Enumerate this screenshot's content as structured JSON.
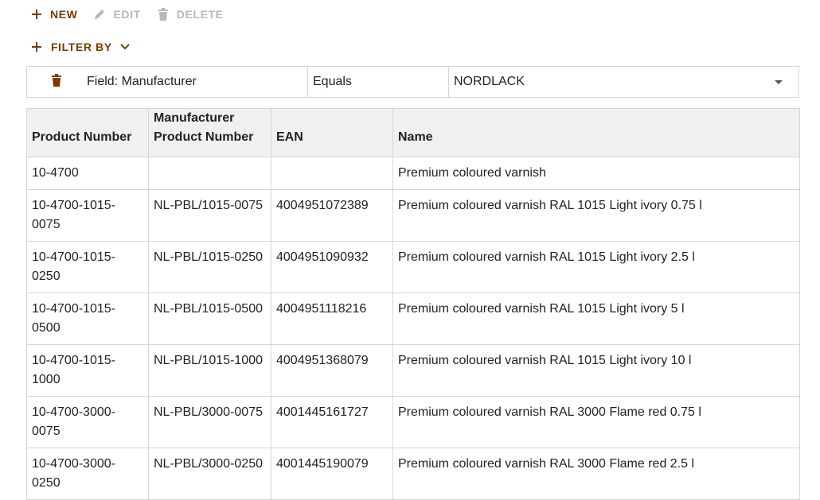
{
  "toolbar": {
    "new_label": "NEW",
    "edit_label": "EDIT",
    "delete_label": "DELETE"
  },
  "filter": {
    "filter_by_label": "FILTER BY",
    "field_label": "Field: Manufacturer",
    "operator": "Equals",
    "value": "NORDLACK"
  },
  "table": {
    "headers": [
      "Product Number",
      "Manufacturer Product Number",
      "EAN",
      "Name"
    ],
    "rows": [
      [
        "10-4700",
        "",
        "",
        "Premium coloured varnish"
      ],
      [
        "10-4700-1015-0075",
        "NL-PBL/1015-0075",
        "4004951072389",
        "Premium coloured varnish RAL 1015 Light ivory 0.75 l"
      ],
      [
        "10-4700-1015-0250",
        "NL-PBL/1015-0250",
        "4004951090932",
        "Premium coloured varnish RAL 1015 Light ivory 2.5 l"
      ],
      [
        "10-4700-1015-0500",
        "NL-PBL/1015-0500",
        "4004951118216",
        "Premium coloured varnish RAL 1015 Light ivory 5 l"
      ],
      [
        "10-4700-1015-1000",
        "NL-PBL/1015-1000",
        "4004951368079",
        "Premium coloured varnish RAL 1015 Light ivory 10 l"
      ],
      [
        "10-4700-3000-0075",
        "NL-PBL/3000-0075",
        "4001445161727",
        "Premium coloured varnish RAL 3000 Flame red 0.75 l"
      ],
      [
        "10-4700-3000-0250",
        "NL-PBL/3000-0250",
        "4001445190079",
        "Premium coloured varnish RAL 3000 Flame red 2.5 l"
      ]
    ]
  },
  "colors": {
    "accent": "#7a3a00",
    "disabled": "#b8b8b8",
    "header_bg": "#f0f0f0",
    "border": "#d6d6d6"
  },
  "icons": {
    "new": "plus-icon",
    "edit": "pencil-icon",
    "delete": "trash-icon",
    "filter_add": "plus-icon",
    "filter_toggle": "chevron-down-icon",
    "filter_remove": "trash-icon",
    "value_dropdown": "caret-down-icon"
  }
}
